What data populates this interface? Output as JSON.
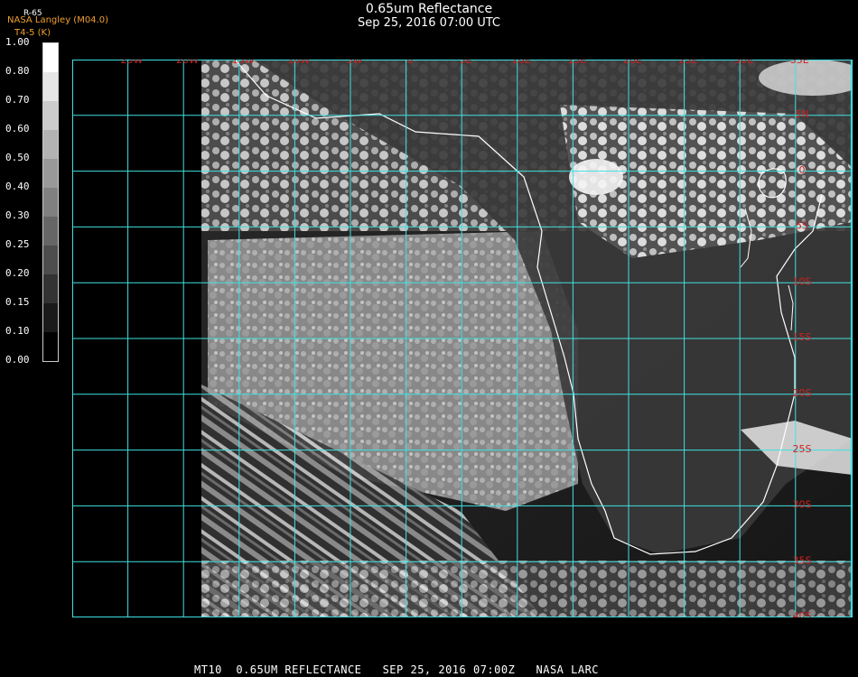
{
  "title": "0.65um Reflectance",
  "subtitle": "Sep 25, 2016 07:00 UTC",
  "credit": {
    "line0": "R-65",
    "line1": "NASA Langley (M04.0)",
    "line2": "T4-5 (K)"
  },
  "colorbar": {
    "labels": [
      "1.00",
      "0.80",
      "0.70",
      "0.60",
      "0.50",
      "0.40",
      "0.30",
      "0.25",
      "0.20",
      "0.15",
      "0.10",
      "0.00"
    ]
  },
  "grid": {
    "lon_labels": [
      "25W",
      "20W",
      "15W",
      "10W",
      "5W",
      "0",
      "5E",
      "10E",
      "15E",
      "20E",
      "25E",
      "30E",
      "35E"
    ],
    "lat_labels": [
      "5N",
      "0",
      "5S",
      "10S",
      "15S",
      "20S",
      "25S",
      "30S",
      "35S",
      "40S"
    ],
    "grid_color": "#40e0e0",
    "label_color": "#d02020"
  },
  "footer": "MT10  0.65UM REFLECTANCE   SEP 25, 2016 07:00Z   NASA LARC"
}
